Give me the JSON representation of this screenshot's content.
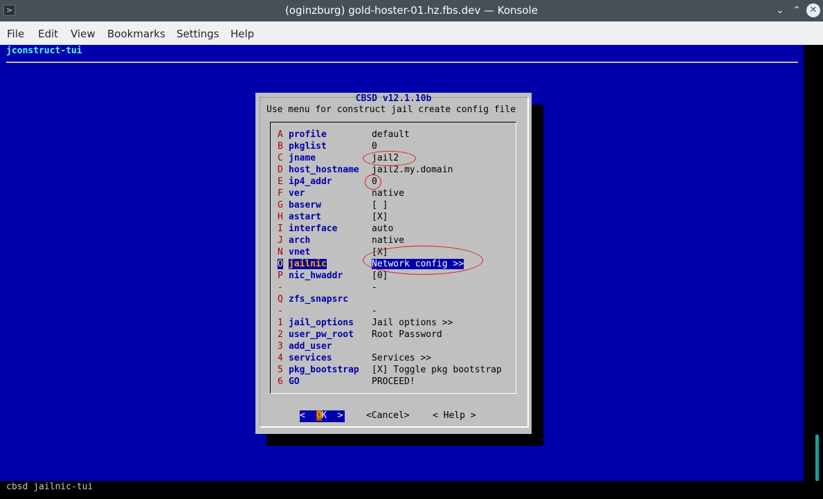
{
  "window": {
    "title": "(oginzburg) gold-hoster-01.hz.fbs.dev — Konsole",
    "app_icon": "terminal-icon",
    "buttons": [
      "chevron-down-icon",
      "chevron-up-icon",
      "close-icon"
    ]
  },
  "menubar": [
    "File",
    "Edit",
    "View",
    "Bookmarks",
    "Settings",
    "Help"
  ],
  "backtitle": "jconstruct-tui",
  "dialog": {
    "title": "CBSD v12.1.10b",
    "prompt": "Use menu for construct jail create config file",
    "items": [
      {
        "key": "A",
        "name": "profile",
        "value": "default"
      },
      {
        "key": "B",
        "name": "pkglist",
        "value": "0"
      },
      {
        "key": "C",
        "name": "jname",
        "value": "jail2"
      },
      {
        "key": "D",
        "name": "host_hostname",
        "value": "jail2.my.domain"
      },
      {
        "key": "E",
        "name": "ip4_addr",
        "value": "0"
      },
      {
        "key": "F",
        "name": "ver",
        "value": "native"
      },
      {
        "key": "G",
        "name": "baserw",
        "value": "[ ]"
      },
      {
        "key": "H",
        "name": "astart",
        "value": "[X]"
      },
      {
        "key": "I",
        "name": "interface",
        "value": "auto"
      },
      {
        "key": "J",
        "name": "arch",
        "value": "native"
      },
      {
        "key": "N",
        "name": "vnet",
        "value": "[X]"
      },
      {
        "key": "O",
        "name": "jailnic",
        "value": "Network config >>",
        "selected": true
      },
      {
        "key": "P",
        "name": "nic_hwaddr",
        "value": "[0]"
      },
      {
        "key": "-",
        "name": "",
        "value": "-"
      },
      {
        "key": "Q",
        "name": "zfs_snapsrc",
        "value": ""
      },
      {
        "key": "-",
        "name": "",
        "value": "-"
      },
      {
        "key": "1",
        "name": "jail_options",
        "value": "Jail options >>"
      },
      {
        "key": "2",
        "name": "user_pw_root",
        "value": "Root Password"
      },
      {
        "key": "3",
        "name": "add_user",
        "value": ""
      },
      {
        "key": "4",
        "name": "services",
        "value": "Services >>"
      },
      {
        "key": "5",
        "name": "pkg_bootstrap",
        "value": "[X] Toggle pkg bootstrap"
      },
      {
        "key": "6",
        "name": "GO",
        "value": "PROCEED!"
      }
    ],
    "buttons": {
      "ok": "<  OK  >",
      "ok_hotkey": "O",
      "cancel": "<Cancel>",
      "help": "< Help >"
    }
  },
  "status_line": "cbsd jailnic-tui",
  "colors": {
    "terminal_bg": "#0000aa",
    "dialog_bg": "#c0c0c0",
    "hotkey": "#aa0000",
    "item_name": "#0000aa",
    "annotation": "#e21818"
  }
}
